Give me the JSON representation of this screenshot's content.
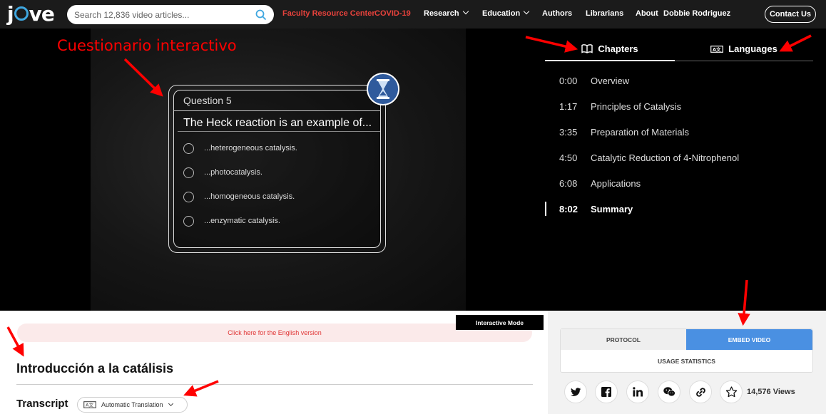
{
  "header": {
    "logo_text": "jove",
    "search": {
      "placeholder": "Search 12,836 video articles..."
    },
    "nav": [
      {
        "label": "Faculty Resource Center",
        "accent": "#e8423c"
      },
      {
        "label": "COVID-19",
        "accent": "#e8423c"
      },
      {
        "label": "Research"
      },
      {
        "label": "Education"
      },
      {
        "label": "Authors"
      },
      {
        "label": "Librarians"
      },
      {
        "label": "About"
      },
      {
        "label": "Dobbie Rodriguez"
      }
    ],
    "contact_label": "Contact Us"
  },
  "annotations": {
    "quiz_callout": "Cuestionario interactivo",
    "color": "#ff0000"
  },
  "quiz": {
    "question_label": "Question 5",
    "question_text": "The Heck reaction is an example of...",
    "options": [
      "...heterogeneous catalysis.",
      "...photocatalysis.",
      "...homogeneous catalysis.",
      "...enzymatic catalysis."
    ],
    "timer_icon": "hourglass-icon"
  },
  "chapters_panel": {
    "tabs": [
      {
        "label": "Chapters",
        "icon": "book-icon",
        "active": true
      },
      {
        "label": "Languages",
        "icon": "language-icon",
        "active": false
      }
    ],
    "chapters": [
      {
        "time": "0:00",
        "title": "Overview"
      },
      {
        "time": "1:17",
        "title": "Principles of Catalysis"
      },
      {
        "time": "3:35",
        "title": "Preparation of Materials"
      },
      {
        "time": "4:50",
        "title": "Catalytic Reduction of 4-Nitrophenol"
      },
      {
        "time": "6:08",
        "title": "Applications"
      },
      {
        "time": "8:02",
        "title": "Summary",
        "active": true
      }
    ]
  },
  "content": {
    "english_version_label": "Click here for the English version",
    "interactive_mode_label": "Interactive Mode",
    "title": "Introducción a la catálisis",
    "transcript_label": "Transcript",
    "translation_select": "Automatic Translation"
  },
  "sidebar": {
    "protocol_label": "PROTOCOL",
    "embed_label": "EMBED VIDEO",
    "embed_color": "#4a90e2",
    "usage_label": "USAGE STATISTICS",
    "share_icons": [
      "twitter-icon",
      "facebook-icon",
      "linkedin-icon",
      "wechat-icon",
      "link-icon",
      "star-icon"
    ],
    "views": "14,576 Views"
  }
}
